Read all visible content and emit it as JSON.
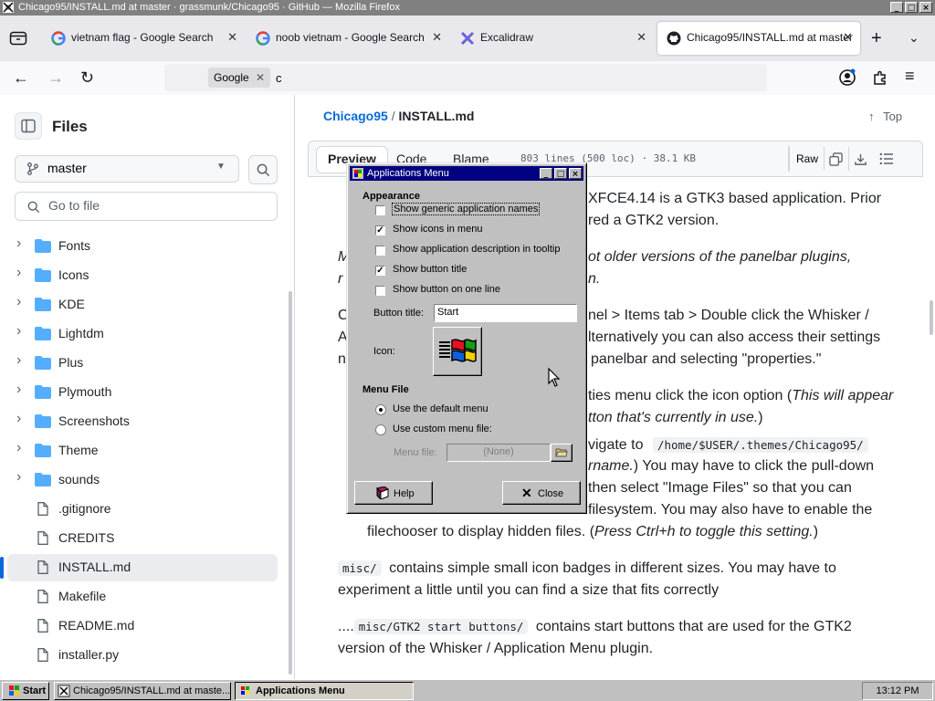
{
  "window": {
    "title": "Chicago95/INSTALL.md at master · grassmunk/Chicago95 · GitHub — Mozilla Firefox",
    "controls": [
      "_",
      "□",
      "×"
    ]
  },
  "tabs": [
    {
      "label": "vietnam flag - Google Search",
      "icon": "google-icon"
    },
    {
      "label": "noob vietnam - Google Search",
      "icon": "google-icon"
    },
    {
      "label": "Excalidraw",
      "icon": "excalidraw-icon"
    },
    {
      "label": "Chicago95/INSTALL.md at master",
      "icon": "github-icon",
      "active": true
    }
  ],
  "nav": {
    "search_engine": "Google",
    "url_text": "c"
  },
  "sidebar": {
    "title": "Files",
    "branch": "master",
    "goto_placeholder": "Go to file",
    "items": [
      {
        "name": "Fonts",
        "type": "folder"
      },
      {
        "name": "Icons",
        "type": "folder"
      },
      {
        "name": "KDE",
        "type": "folder"
      },
      {
        "name": "Lightdm",
        "type": "folder"
      },
      {
        "name": "Plus",
        "type": "folder"
      },
      {
        "name": "Plymouth",
        "type": "folder"
      },
      {
        "name": "Screenshots",
        "type": "folder"
      },
      {
        "name": "Theme",
        "type": "folder"
      },
      {
        "name": "sounds",
        "type": "folder"
      },
      {
        "name": ".gitignore",
        "type": "file"
      },
      {
        "name": "CREDITS",
        "type": "file"
      },
      {
        "name": "INSTALL.md",
        "type": "file",
        "selected": true
      },
      {
        "name": "Makefile",
        "type": "file"
      },
      {
        "name": "README.md",
        "type": "file"
      },
      {
        "name": "installer.py",
        "type": "file"
      }
    ]
  },
  "main": {
    "repo": "Chicago95",
    "sep": "/",
    "file": "INSTALL.md",
    "top_label": "Top",
    "views": [
      "Preview",
      "Code",
      "Blame"
    ],
    "line_info": "803 lines (500 loc) · 38.1 KB",
    "raw_label": "Raw",
    "text": {
      "l1": "XFCE4.14 is a GTK3 based application. Prior",
      "l2": "red a GTK2 version.",
      "l3": "ot older versions of the panelbar plugins,",
      "l3a": "M",
      "l4a": "r",
      "l4": "n.",
      "l5a": "C",
      "l5": "nel > Items tab > Double click the Whisker /",
      "l6a": "A",
      "l6": "lternatively you can also access their settings",
      "l7a": "n",
      "l7": "panelbar and selecting \"properties.\"",
      "l8": "ties menu click the icon option (",
      "l8i": "This will appear",
      "l9i": "tton that's currently in use.",
      "l9": ")",
      "l10": "vigate to",
      "l10c": "/home/$USER/.themes/Chicago95/",
      "l11i": "rname.",
      "l11": ") You may have to click the pull-down",
      "l12": "then select \"Image Files\" so that you can",
      "l13": "filesystem. You may also have to enable the",
      "l14": "filechooser to display hidden files. (",
      "l14i": "Press Ctrl+h to toggle this setting.",
      "l14e": ")",
      "p2c": "misc/",
      "p2": "contains simple small icon badges in different sizes. You may have to",
      "p2b": "experiment a little until you can find a size that fits correctly",
      "p3a": "....",
      "p3c": "misc/GTK2 start buttons/",
      "p3": "contains start buttons that are used for the GTK2",
      "p3b": "version of the Whisker / Application Menu plugin."
    }
  },
  "dialog": {
    "title": "Applications Menu",
    "appearance_label": "Appearance",
    "options": [
      {
        "label": "Show generic application names",
        "checked": false
      },
      {
        "label": "Show icons in menu",
        "checked": true
      },
      {
        "label": "Show application description in tooltip",
        "checked": false
      },
      {
        "label": "Show button title",
        "checked": true
      },
      {
        "label": "Show button on one line",
        "checked": false
      }
    ],
    "button_title_label": "Button title:",
    "button_title_value": "Start",
    "icon_label": "Icon:",
    "menu_file_label": "Menu File",
    "radio_default": "Use the default menu",
    "radio_custom": "Use custom menu file:",
    "menu_file_field_label": "Menu file:",
    "menu_file_value": "(None)",
    "help_label": "Help",
    "close_label": "Close"
  },
  "taskbar": {
    "start_label": "Start",
    "items": [
      "Chicago95/INSTALL.md at maste...",
      "Applications Menu"
    ],
    "clock": "13:12 PM"
  }
}
